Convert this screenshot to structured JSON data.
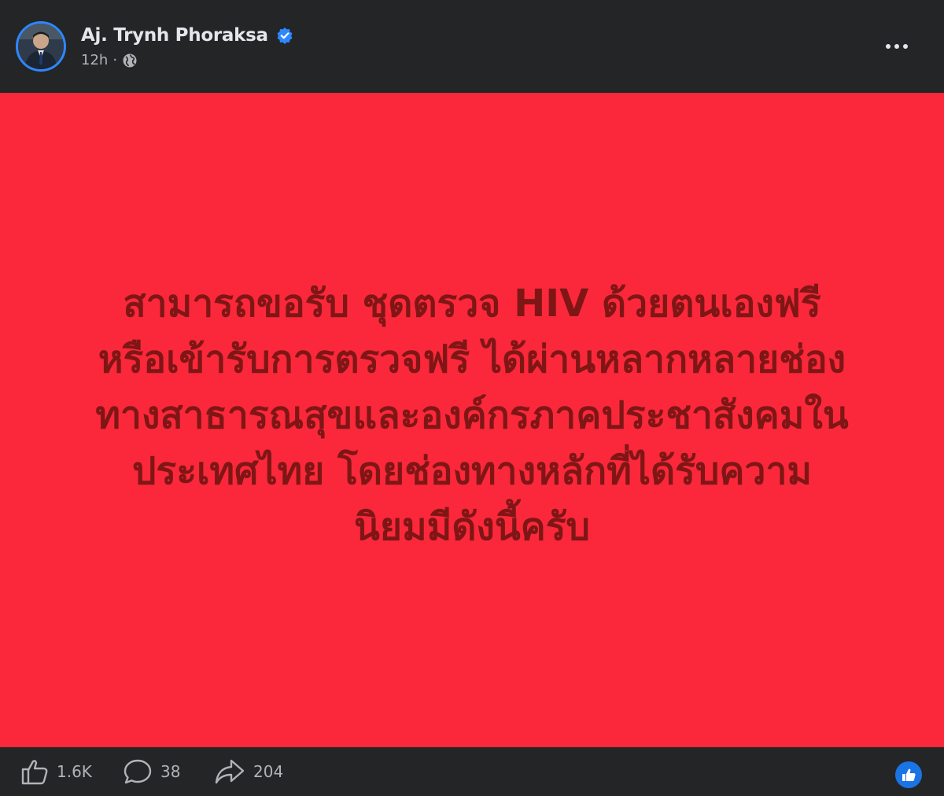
{
  "post": {
    "author_name": "Aj. Trynh Phoraksa",
    "verified_icon": "verified-badge-icon",
    "timestamp": "12h",
    "separator": "·",
    "privacy_icon": "globe-icon",
    "more_icon": "more-options-icon",
    "image": {
      "background_color": "#fa283a",
      "text_color": "#7f1616",
      "lines": [
        "สามารถขอรับ ชุดตรวจ HIV ด้วยตนเองฟรี",
        "หรือเข้ารับการตรวจฟรี ได้ผ่านหลากหลายช่อง",
        "ทางสาธารณสุขและองค์กรภาคประชาสังคมใน",
        "ประเทศไทย โดยช่องทางหลักที่ได้รับความ",
        "นิยมมีดังนี้ครับ"
      ]
    },
    "actions": {
      "like_count": "1.6K",
      "comment_count": "38",
      "share_count": "204"
    },
    "reaction_icon": "like-reaction-icon",
    "accent_color": "#1b74e4"
  }
}
